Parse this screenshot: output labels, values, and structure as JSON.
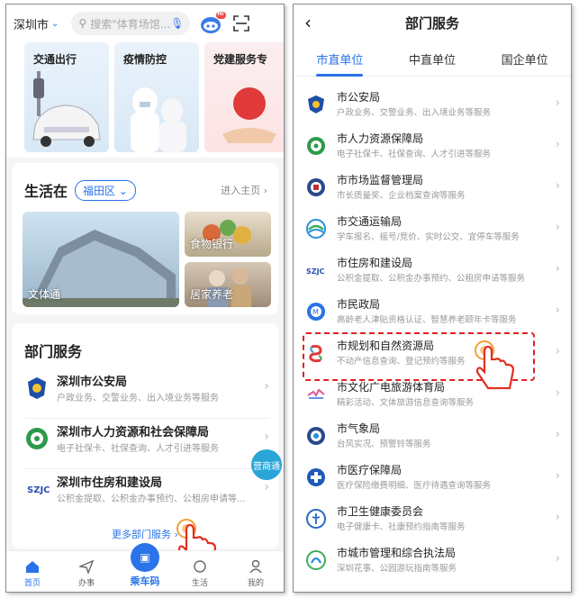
{
  "left": {
    "city": "深圳市",
    "search_placeholder": "搜索\"体育场馆...",
    "robot_badge": "Hi",
    "categories": [
      "交通出行",
      "疫情防控",
      "党建服务专"
    ],
    "life": {
      "title": "生活在",
      "district": "福田区",
      "enter": "进入主页",
      "images": [
        "文体通",
        "食物银行",
        "居家养老"
      ]
    },
    "dept": {
      "title": "部门服务",
      "items": [
        {
          "name": "深圳市公安局",
          "desc": "户政业务、交警业务、出入境业务等服务"
        },
        {
          "name": "深圳市人力资源和社会保障局",
          "desc": "电子社保卡、社保查询、人才引进等服务"
        },
        {
          "name": "深圳市住房和建设局",
          "desc": "公积金提取、公积金办事预约、公租房申请等..."
        }
      ],
      "more": "更多部门服务",
      "pill": "营商通"
    },
    "nav": {
      "home": "首页",
      "work": "办事",
      "bus": "乘车码",
      "life": "生活",
      "mine": "我的"
    }
  },
  "right": {
    "title": "部门服务",
    "tabs": [
      "市直单位",
      "中直单位",
      "国企单位"
    ],
    "items": [
      {
        "name": "市公安局",
        "desc": "户政业务、交警业务、出入境业务等服务"
      },
      {
        "name": "市人力资源保障局",
        "desc": "电子社保卡、社保查询、人才引进等服务"
      },
      {
        "name": "市市场监督管理局",
        "desc": "市长质量奖、企业档案查询等服务"
      },
      {
        "name": "市交通运输局",
        "desc": "学车报名、摇号/竞价、实时公交、宜停车等服务"
      },
      {
        "name": "市住房和建设局",
        "desc": "公积金提取、公积金办事预约、公租房申请等服务"
      },
      {
        "name": "市民政局",
        "desc": "高龄老人津贴资格认证、智慧养老颐年卡等服务"
      },
      {
        "name": "市规划和自然资源局",
        "desc": "不动产信息查询、登记预约等服务"
      },
      {
        "name": "市文化广电旅游体育局",
        "desc": "精彩活动、文体旅游信息查询等服务"
      },
      {
        "name": "市气象局",
        "desc": "台风实况、预警铃等服务"
      },
      {
        "name": "市医疗保障局",
        "desc": "医疗保险缴费明细、医疗待遇查询等服务"
      },
      {
        "name": "市卫生健康委员会",
        "desc": "电子健康卡、社康预约指南等服务"
      },
      {
        "name": "市城市管理和综合执法局",
        "desc": "深圳花事、公园游玩指南等服务"
      }
    ]
  },
  "colors": {
    "accent": "#2a73e8",
    "highlight": "#e02020"
  }
}
